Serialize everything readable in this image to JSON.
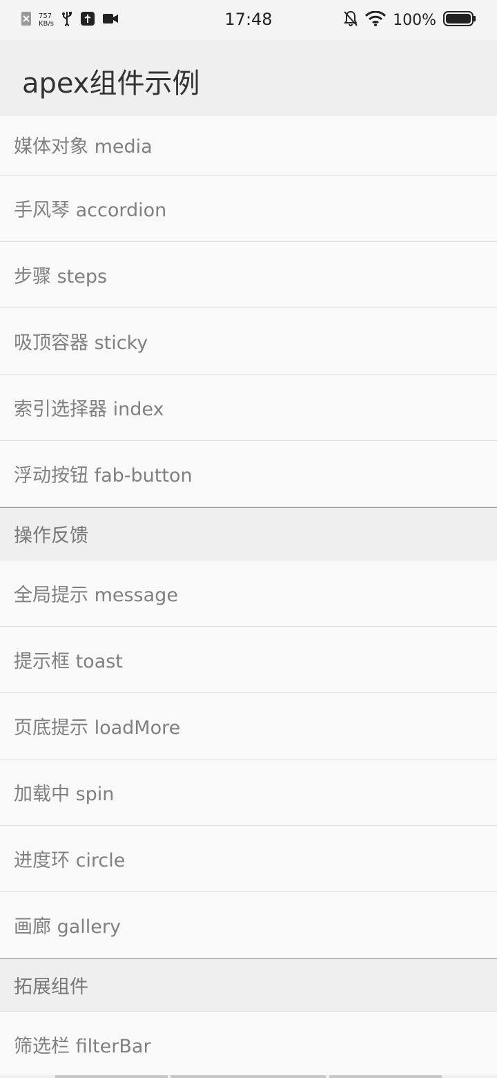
{
  "status_bar": {
    "net_speed_value": "757",
    "net_speed_unit": "KB/s",
    "time": "17:48",
    "battery": "100%",
    "icons_left": [
      "sim-off-icon",
      "usb-icon",
      "usb-debug-icon",
      "screen-record-icon"
    ],
    "icons_right": [
      "bell-off-icon",
      "wifi-icon",
      "battery-icon"
    ]
  },
  "header": {
    "title": "apex组件示例"
  },
  "list_a": [
    {
      "label": "媒体对象 media"
    },
    {
      "label": "手风琴 accordion"
    },
    {
      "label": "步骤 steps"
    },
    {
      "label": "吸顶容器 sticky"
    },
    {
      "label": "索引选择器 index"
    },
    {
      "label": "浮动按钮 fab-button"
    }
  ],
  "section_feedback": {
    "title": "操作反馈"
  },
  "list_b": [
    {
      "label": "全局提示 message"
    },
    {
      "label": "提示框 toast"
    },
    {
      "label": "页底提示 loadMore"
    },
    {
      "label": "加载中 spin"
    },
    {
      "label": "进度环 circle"
    },
    {
      "label": "画廊 gallery"
    }
  ],
  "section_extend": {
    "title": "拓展组件"
  },
  "list_c": [
    {
      "label": "筛选栏 filterBar"
    }
  ]
}
